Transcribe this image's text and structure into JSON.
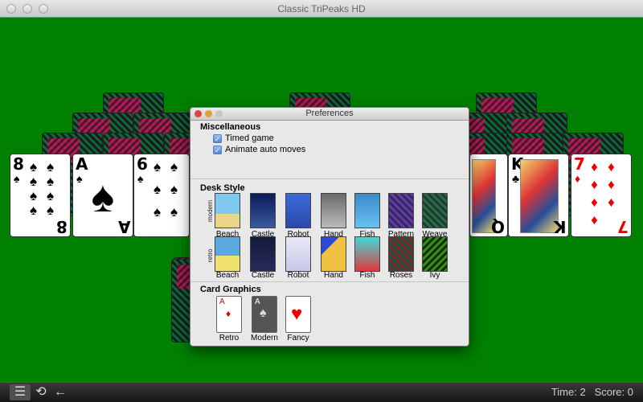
{
  "window": {
    "title": "Classic TriPeaks HD"
  },
  "status": {
    "time_label": "Time:",
    "time_value": "2",
    "score_label": "Score:",
    "score_value": "0"
  },
  "toolbar": {
    "menu_icon": "list-icon",
    "undo_icon": "refresh-icon",
    "back_icon": "back-arrow-icon"
  },
  "cards": [
    {
      "rank": "8",
      "suit": "♠",
      "color": "#000000"
    },
    {
      "rank": "A",
      "suit": "♠",
      "color": "#000000"
    },
    {
      "rank": "6",
      "suit": "♠",
      "color": "#000000"
    },
    {
      "rank": "Q",
      "suit": "♣",
      "color": "#000000"
    },
    {
      "rank": "K",
      "suit": "♣",
      "color": "#000000"
    },
    {
      "rank": "7",
      "suit": "♦",
      "color": "#e00000"
    }
  ],
  "prefs": {
    "title": "Preferences",
    "misc": {
      "heading": "Miscellaneous",
      "timed_game": "Timed game",
      "animate_auto_moves": "Animate auto moves"
    },
    "desk_style": {
      "heading": "Desk Style",
      "modern_label": "modern",
      "retro_label": "retro",
      "modern": [
        "Beach",
        "Castle",
        "Robot",
        "Hand",
        "Fish",
        "Pattern",
        "Weave"
      ],
      "retro": [
        "Beach",
        "Castle",
        "Robot",
        "Hand",
        "Fish",
        "Roses",
        "Ivy"
      ]
    },
    "card_graphics": {
      "heading": "Card Graphics",
      "options": [
        "Retro",
        "Modern",
        "Fancy"
      ]
    }
  },
  "colors": {
    "felt": "#008000",
    "checkbox": "#4a86d8"
  }
}
